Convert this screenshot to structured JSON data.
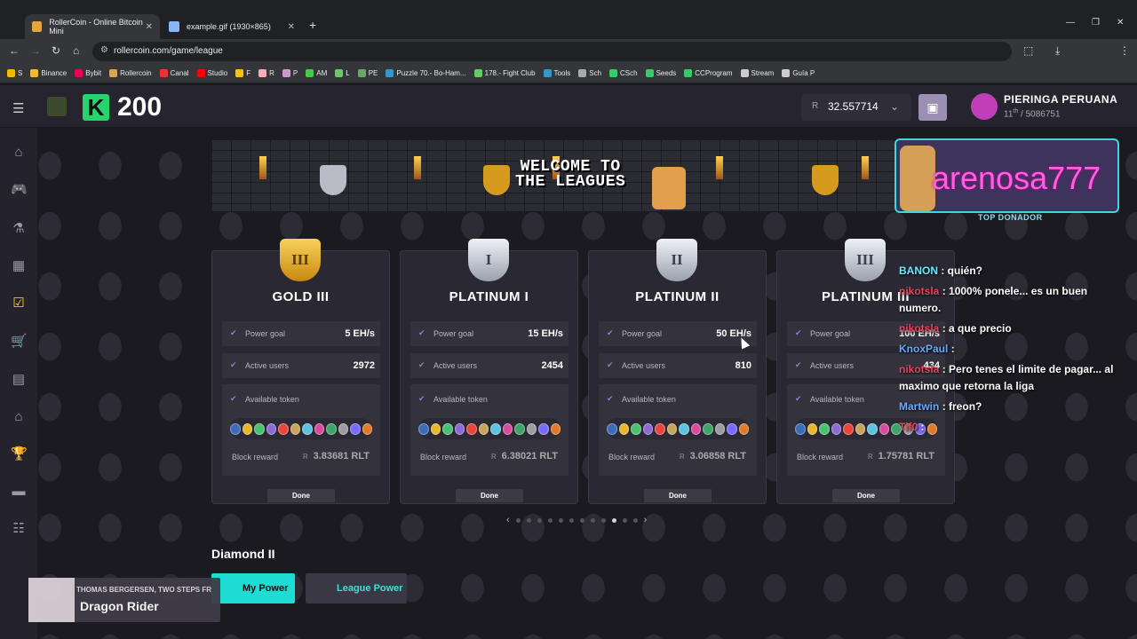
{
  "browser": {
    "tabs": [
      {
        "title": "RollerCoin - Online Bitcoin Mini",
        "active": true
      },
      {
        "title": "example.gif (1930×865)",
        "active": false
      }
    ],
    "url": "rollercoin.com/game/league",
    "bookmarks": [
      "S",
      "Binance",
      "Bybit",
      "Rollercoin",
      "Canal",
      "Studio",
      "F",
      "R",
      "P",
      "AM",
      "L",
      "PE",
      "Puzzle 70.- Bo-Ham...",
      "178.- Fight Club",
      "Tools",
      "Sch",
      "CSch",
      "Seeds",
      "CCProgram",
      "Stream",
      "Guía P"
    ]
  },
  "header": {
    "score": "200",
    "balance": "32.557714",
    "balance_currency": "R",
    "player_name": "PIERINGA PERUANA",
    "player_rank_prefix": "11",
    "player_rank_suffix": "th",
    "player_rank_total": "/ 5086751"
  },
  "banner": {
    "line1": "WELCOME TO",
    "line2": "THE LEAGUES"
  },
  "donor": {
    "name": "arenosa777",
    "label": "TOP DONADOR"
  },
  "leagues": [
    {
      "title": "GOLD III",
      "roman": "III",
      "metal": "gold",
      "power_label": "Power goal",
      "power": "5 EH/s",
      "users_label": "Active users",
      "users": "2972",
      "token_label": "Available token",
      "reward_label": "Block reward",
      "reward": "3.83681 RLT",
      "button": "Done"
    },
    {
      "title": "PLATINUM I",
      "roman": "I",
      "metal": "platinum",
      "power_label": "Power goal",
      "power": "15 EH/s",
      "users_label": "Active users",
      "users": "2454",
      "token_label": "Available token",
      "reward_label": "Block reward",
      "reward": "6.38021 RLT",
      "button": "Done"
    },
    {
      "title": "PLATINUM II",
      "roman": "II",
      "metal": "platinum",
      "power_label": "Power goal",
      "power": "50 EH/s",
      "users_label": "Active users",
      "users": "810",
      "token_label": "Available token",
      "reward_label": "Block reward",
      "reward": "3.06858 RLT",
      "button": "Done"
    },
    {
      "title": "PLATINUM III",
      "roman": "III",
      "metal": "platinum",
      "power_label": "Power goal",
      "power": "100 EH/s",
      "users_label": "Active users",
      "users": "434",
      "token_label": "Available token",
      "reward_label": "Block reward",
      "reward": "1.75781 RLT",
      "button": "Done"
    }
  ],
  "token_colors": [
    "#3d6db8",
    "#e7b62b",
    "#4ac070",
    "#8c6bd8",
    "#e8453c",
    "#c8a45b",
    "#5bc3e0",
    "#d84ca0",
    "#3fa36b",
    "#9d9d9d",
    "#7a6bff",
    "#e07b2e"
  ],
  "pager": {
    "count": 12,
    "active_index": 9
  },
  "section_title": "Diamond II",
  "tabs": {
    "my_power": "My Power",
    "league_power": "League Power"
  },
  "chat": [
    {
      "user": "BANON",
      "msg": ": quién?",
      "cls": "u1"
    },
    {
      "user": "nikotsla",
      "msg": ": 1000% ponele... es un buen numero.",
      "cls": "u2"
    },
    {
      "user": "nikotsla",
      "msg": ": a que precio",
      "cls": "u2"
    },
    {
      "user": "KnoxPaul",
      "msg": ":",
      "cls": "u3"
    },
    {
      "user": "nikotsla",
      "msg": ": Pero tenes el limite de pagar... al maximo que retorna la liga",
      "cls": "u2"
    },
    {
      "user": "Martwin",
      "msg": ": freon?",
      "cls": "u3"
    },
    {
      "user": "Tif0",
      "msg": ":",
      "cls": "u2"
    }
  ],
  "music": {
    "artist": "THOMAS BERGERSEN, TWO STEPS FR",
    "title": "Dragon Rider"
  }
}
